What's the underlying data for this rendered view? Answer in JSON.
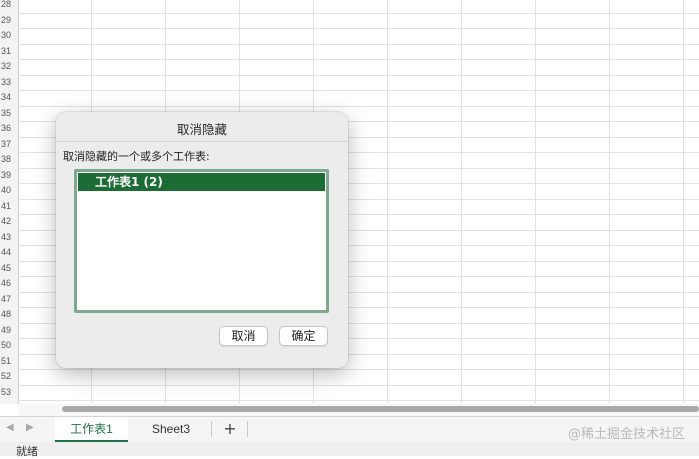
{
  "grid": {
    "row_numbers": [
      "28",
      "29",
      "30",
      "31",
      "32",
      "33",
      "34",
      "35",
      "36",
      "37",
      "38",
      "39",
      "40",
      "41",
      "42",
      "43",
      "44",
      "45",
      "46",
      "47",
      "48",
      "49",
      "50",
      "51",
      "52",
      "53"
    ]
  },
  "dialog": {
    "title": "取消隐藏",
    "label": "取消隐藏的一个或多个工作表:",
    "items": [
      "工作表1 (2)"
    ],
    "cancel_label": "取消",
    "ok_label": "确定"
  },
  "sheet_tabs": {
    "tabs": [
      {
        "label": "工作表1",
        "active": true
      },
      {
        "label": "Sheet3",
        "active": false
      }
    ],
    "add_symbol": "+",
    "prev_symbol": "◀",
    "next_symbol": "▶"
  },
  "status": {
    "text": "就绪"
  },
  "watermark": "@稀土掘金技术社区",
  "colors": {
    "accent": "#1d6b35",
    "tab_active": "#1e7145"
  }
}
